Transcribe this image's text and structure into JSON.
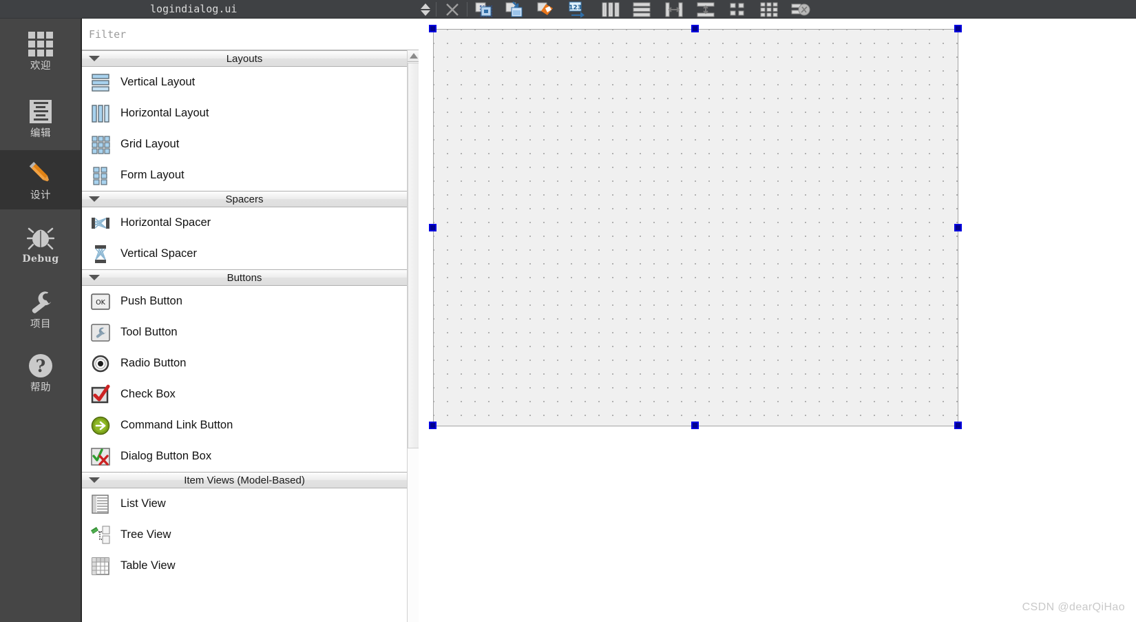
{
  "app": {
    "mode_bar": {
      "items": [
        {
          "label": "欢迎",
          "icon": "grid-apps-icon",
          "active": false
        },
        {
          "label": "编辑",
          "icon": "document-lines-icon",
          "active": false
        },
        {
          "label": "设计",
          "icon": "pencil-icon",
          "active": true
        },
        {
          "label": "Debug",
          "icon": "bug-icon",
          "active": false
        },
        {
          "label": "项目",
          "icon": "wrench-icon",
          "active": false
        },
        {
          "label": "帮助",
          "icon": "question-circle-icon",
          "active": false
        }
      ]
    },
    "editor_toolbar": {
      "document_title": "logindialog.ui",
      "nav_spinner": "up-down-arrows-icon",
      "close_label": "close-icon",
      "buttons": [
        {
          "name": "edit-widgets-icon",
          "tooltip": "Edit Widgets"
        },
        {
          "name": "edit-signals-slots-icon",
          "tooltip": "Edit Signals/Slots"
        },
        {
          "name": "edit-buddies-icon",
          "tooltip": "Edit Buddies"
        },
        {
          "name": "edit-tab-order-icon",
          "tooltip": "Edit Tab Order"
        },
        {
          "name": "layout-horizontally-icon",
          "tooltip": "Lay Out Horizontally"
        },
        {
          "name": "layout-vertically-icon",
          "tooltip": "Lay Out Vertically"
        },
        {
          "name": "layout-horizontal-splitter-icon",
          "tooltip": "Lay Out Horizontally in Splitter"
        },
        {
          "name": "layout-vertical-splitter-icon",
          "tooltip": "Lay Out Vertically in Splitter"
        },
        {
          "name": "layout-form-icon",
          "tooltip": "Lay Out in a Form Layout"
        },
        {
          "name": "layout-grid-icon",
          "tooltip": "Lay Out in a Grid"
        },
        {
          "name": "break-layout-icon",
          "tooltip": "Break Layout"
        }
      ]
    },
    "widget_box": {
      "filter": {
        "value": "",
        "placeholder": "Filter"
      },
      "categories": [
        {
          "title": "Layouts",
          "expanded": true,
          "items": [
            {
              "label": "Vertical Layout",
              "icon": "vertical-layout-icon"
            },
            {
              "label": "Horizontal Layout",
              "icon": "horizontal-layout-icon"
            },
            {
              "label": "Grid Layout",
              "icon": "grid-layout-icon"
            },
            {
              "label": "Form Layout",
              "icon": "form-layout-icon"
            }
          ]
        },
        {
          "title": "Spacers",
          "expanded": true,
          "items": [
            {
              "label": "Horizontal Spacer",
              "icon": "horizontal-spacer-icon"
            },
            {
              "label": "Vertical Spacer",
              "icon": "vertical-spacer-icon"
            }
          ]
        },
        {
          "title": "Buttons",
          "expanded": true,
          "items": [
            {
              "label": "Push Button",
              "icon": "push-button-icon"
            },
            {
              "label": "Tool Button",
              "icon": "tool-button-icon"
            },
            {
              "label": "Radio Button",
              "icon": "radio-button-icon"
            },
            {
              "label": "Check Box",
              "icon": "check-box-icon"
            },
            {
              "label": "Command Link Button",
              "icon": "command-link-button-icon"
            },
            {
              "label": "Dialog Button Box",
              "icon": "dialog-button-box-icon"
            }
          ]
        },
        {
          "title": "Item Views (Model-Based)",
          "expanded": true,
          "items": [
            {
              "label": "List View",
              "icon": "list-view-icon"
            },
            {
              "label": "Tree View",
              "icon": "tree-view-icon"
            },
            {
              "label": "Table View",
              "icon": "table-view-icon"
            }
          ]
        }
      ]
    },
    "canvas": {
      "form_name": "form-widget",
      "selected": true,
      "handle_count": 8
    },
    "watermark": "CSDN @dearQiHao",
    "colors": {
      "mode_bar_bg": "#464646",
      "mode_bar_active": "#333333",
      "toolbar_bg": "#3f4144",
      "accent_orange": "#e08214",
      "selection_blue": "#0000e0",
      "form_bg": "#f0f0f0"
    }
  }
}
